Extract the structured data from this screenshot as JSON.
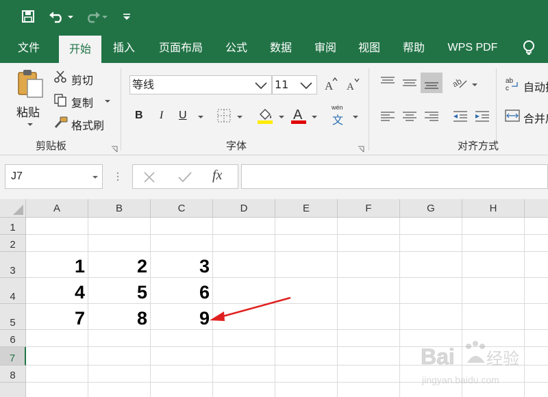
{
  "window": {
    "qat": {
      "save_icon": "save-icon",
      "undo_icon": "undo-icon",
      "redo_icon": "redo-icon",
      "customize_icon": "customize-qat-icon"
    },
    "accent_color": "#217346"
  },
  "tabs": [
    {
      "label": "文件"
    },
    {
      "label": "开始"
    },
    {
      "label": "插入"
    },
    {
      "label": "页面布局"
    },
    {
      "label": "公式"
    },
    {
      "label": "数据"
    },
    {
      "label": "审阅"
    },
    {
      "label": "视图"
    },
    {
      "label": "帮助"
    },
    {
      "label": "WPS PDF"
    }
  ],
  "active_tab": "开始",
  "ribbon": {
    "clipboard": {
      "paste_label": "粘贴",
      "cut_label": "剪切",
      "copy_label": "复制",
      "format_painter_label": "格式刷",
      "group_label": "剪贴板"
    },
    "font": {
      "font_name": "等线",
      "font_size": "11",
      "bold": "B",
      "italic": "I",
      "underline": "U",
      "font_color_letter": "A",
      "phonetic_top": "wén",
      "phonetic_bottom": "文",
      "group_label": "字体"
    },
    "alignment": {
      "wrap_label": "自动换",
      "merge_label": "合并后",
      "group_label": "对齐方式"
    }
  },
  "formula_bar": {
    "name_box": "J7",
    "fx_label": "fx",
    "formula": ""
  },
  "sheet": {
    "columns": [
      "A",
      "B",
      "C",
      "D",
      "E",
      "F",
      "G",
      "H"
    ],
    "rows": [
      "1",
      "2",
      "3",
      "4",
      "5",
      "6",
      "7",
      "8"
    ],
    "selected_row": "7",
    "cells": {
      "A3": "1",
      "B3": "2",
      "C3": "3",
      "A4": "4",
      "B4": "5",
      "C4": "6",
      "A5": "7",
      "B5": "8",
      "C5": "9"
    }
  },
  "watermark": {
    "brand": "Bai",
    "brand_cn": "经验",
    "url": "jingyan.baidu.com"
  }
}
